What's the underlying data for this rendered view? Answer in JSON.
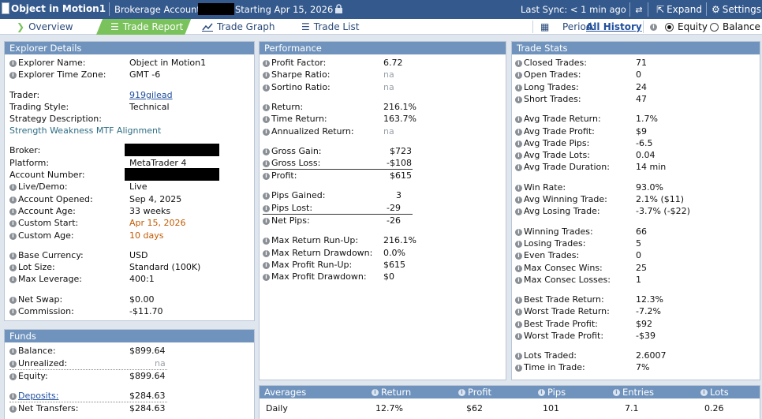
{
  "topbar": {
    "title": "Object in Motion1",
    "account_type": "Brokerage Account",
    "starting": "Starting Apr 15, 2026",
    "last_sync": "Last Sync: < 1 min ago",
    "expand": "Expand",
    "settings": "Settings"
  },
  "tabs": {
    "overview": "Overview",
    "trade_report": "Trade Report",
    "trade_graph": "Trade Graph",
    "trade_list": "Trade List",
    "period_label": "Period:",
    "period_value": "All History",
    "equity": "Equity",
    "balance": "Balance"
  },
  "explorer": {
    "title": "Explorer Details",
    "name_label": "Explorer Name:",
    "name": "Object in Motion1",
    "tz_label": "Explorer Time Zone:",
    "tz": "GMT -6",
    "trader_label": "Trader:",
    "trader": "919gilead",
    "style_label": "Trading Style:",
    "style": "Technical",
    "strategy_label": "Strategy Description:",
    "strategy": "Strength Weakness MTF Alignment",
    "broker_label": "Broker:",
    "platform_label": "Platform:",
    "platform": "MetaTrader 4",
    "account_label": "Account Number:",
    "live_label": "Live/Demo:",
    "live": "Live",
    "opened_label": "Account Opened:",
    "opened": "Sep 4, 2025",
    "age_label": "Account Age:",
    "age": "33 weeks",
    "cstart_label": "Custom Start:",
    "cstart": "Apr 15, 2026",
    "cage_label": "Custom Age:",
    "cage": "10 days",
    "currency_label": "Base Currency:",
    "currency": "USD",
    "lot_label": "Lot Size:",
    "lot": "Standard (100K)",
    "lev_label": "Max Leverage:",
    "lev": "400:1",
    "swap_label": "Net Swap:",
    "swap": "$0.00",
    "comm_label": "Commission:",
    "comm": "-$11.70"
  },
  "funds": {
    "title": "Funds",
    "balance_label": "Balance:",
    "balance": "$899.64",
    "unreal_label": "Unrealized:",
    "unreal": "na",
    "equity_label": "Equity:",
    "equity": "$899.64",
    "deposits_label": "Deposits:",
    "deposits": "$284.63",
    "transfers_label": "Net Transfers:",
    "transfers": "$284.63"
  },
  "performance": {
    "title": "Performance",
    "pf_label": "Profit Factor:",
    "pf": "6.72",
    "sharpe_label": "Sharpe Ratio:",
    "sharpe": "na",
    "sortino_label": "Sortino Ratio:",
    "sortino": "na",
    "return_label": "Return:",
    "return": "216.1%",
    "time_return_label": "Time Return:",
    "time_return": "163.7%",
    "ann_label": "Annualized Return:",
    "ann": "na",
    "gain_label": "Gross Gain:",
    "gain": "$723",
    "loss_label": "Gross Loss:",
    "loss": "-$108",
    "profit_label": "Profit:",
    "profit": "$615",
    "pips_gained_label": "Pips Gained:",
    "pips_gained": "3",
    "pips_lost_label": "Pips Lost:",
    "pips_lost": "-29",
    "net_pips_label": "Net Pips:",
    "net_pips": "-26",
    "mrru_label": "Max Return Run-Up:",
    "mrru": "216.1%",
    "mrdd_label": "Max Return Drawdown:",
    "mrdd": "0.0%",
    "mpru_label": "Max Profit Run-Up:",
    "mpru": "$615",
    "mpdd_label": "Max Profit Drawdown:",
    "mpdd": "$0"
  },
  "stats": {
    "title": "Trade Stats",
    "closed_label": "Closed Trades:",
    "closed": "71",
    "open_label": "Open Trades:",
    "open": "0",
    "long_label": "Long Trades:",
    "long": "24",
    "short_label": "Short Trades:",
    "short": "47",
    "atr_label": "Avg Trade Return:",
    "atr": "1.7%",
    "atp_label": "Avg Trade Profit:",
    "atp": "$9",
    "atpips_label": "Avg Trade Pips:",
    "atpips": "-6.5",
    "atl_label": "Avg Trade Lots:",
    "atl": "0.04",
    "atd_label": "Avg Trade Duration:",
    "atd": "14 min",
    "win_label": "Win Rate:",
    "win": "93.0%",
    "awt_label": "Avg Winning Trade:",
    "awt": "2.1% ($11)",
    "alt_label": "Avg Losing Trade:",
    "alt": "-3.7% (-$22)",
    "wt_label": "Winning Trades:",
    "wt": "66",
    "lt_label": "Losing Trades:",
    "lt": "5",
    "et_label": "Even Trades:",
    "et": "0",
    "mcw_label": "Max Consec Wins:",
    "mcw": "25",
    "mcl_label": "Max Consec Losses:",
    "mcl": "1",
    "btr_label": "Best Trade Return:",
    "btr": "12.3%",
    "wtr_label": "Worst Trade Return:",
    "wtr": "-7.2%",
    "btp_label": "Best Trade Profit:",
    "btp": "$92",
    "wtp_label": "Worst Trade Profit:",
    "wtp": "-$39",
    "lots_label": "Lots Traded:",
    "lots": "2.6007",
    "tit_label": "Time in Trade:",
    "tit": "7%"
  },
  "averages": {
    "title": "Averages",
    "headers": [
      "Return",
      "Profit",
      "Pips",
      "Entries",
      "Lots"
    ],
    "rows": [
      {
        "period": "Daily",
        "values": [
          "12.7%",
          "$62",
          "101",
          "7.1",
          "0.26"
        ]
      }
    ]
  }
}
